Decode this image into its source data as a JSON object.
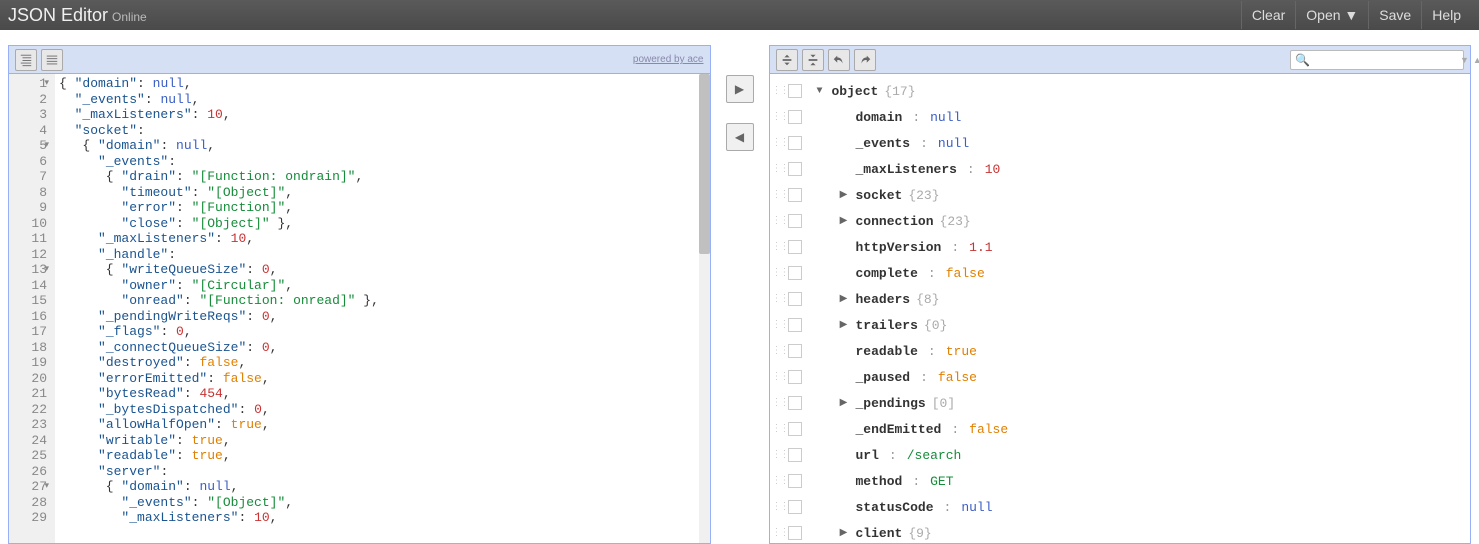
{
  "header": {
    "brand": "JSON Editor",
    "brand_sub": "Online",
    "menu": [
      "Clear",
      "Open ▼",
      "Save",
      "Help"
    ]
  },
  "left_panel": {
    "powered": "powered by ace",
    "code_lines": [
      {
        "n": 1,
        "fold": true,
        "tokens": [
          {
            "t": "punc",
            "v": "{ "
          },
          {
            "t": "key",
            "v": "\"domain\""
          },
          {
            "t": "punc",
            "v": ": "
          },
          {
            "t": "null",
            "v": "null"
          },
          {
            "t": "punc",
            "v": ","
          }
        ]
      },
      {
        "n": 2,
        "tokens": [
          {
            "t": "punc",
            "v": "  "
          },
          {
            "t": "key",
            "v": "\"_events\""
          },
          {
            "t": "punc",
            "v": ": "
          },
          {
            "t": "null",
            "v": "null"
          },
          {
            "t": "punc",
            "v": ","
          }
        ]
      },
      {
        "n": 3,
        "tokens": [
          {
            "t": "punc",
            "v": "  "
          },
          {
            "t": "key",
            "v": "\"_maxListeners\""
          },
          {
            "t": "punc",
            "v": ": "
          },
          {
            "t": "num",
            "v": "10"
          },
          {
            "t": "punc",
            "v": ","
          }
        ]
      },
      {
        "n": 4,
        "tokens": [
          {
            "t": "punc",
            "v": "  "
          },
          {
            "t": "key",
            "v": "\"socket\""
          },
          {
            "t": "punc",
            "v": ":"
          }
        ]
      },
      {
        "n": 5,
        "fold": true,
        "tokens": [
          {
            "t": "punc",
            "v": "   { "
          },
          {
            "t": "key",
            "v": "\"domain\""
          },
          {
            "t": "punc",
            "v": ": "
          },
          {
            "t": "null",
            "v": "null"
          },
          {
            "t": "punc",
            "v": ","
          }
        ]
      },
      {
        "n": 6,
        "tokens": [
          {
            "t": "punc",
            "v": "     "
          },
          {
            "t": "key",
            "v": "\"_events\""
          },
          {
            "t": "punc",
            "v": ":"
          }
        ]
      },
      {
        "n": 7,
        "tokens": [
          {
            "t": "punc",
            "v": "      { "
          },
          {
            "t": "key",
            "v": "\"drain\""
          },
          {
            "t": "punc",
            "v": ": "
          },
          {
            "t": "str",
            "v": "\"[Function: ondrain]\""
          },
          {
            "t": "punc",
            "v": ","
          }
        ]
      },
      {
        "n": 8,
        "tokens": [
          {
            "t": "punc",
            "v": "        "
          },
          {
            "t": "key",
            "v": "\"timeout\""
          },
          {
            "t": "punc",
            "v": ": "
          },
          {
            "t": "str",
            "v": "\"[Object]\""
          },
          {
            "t": "punc",
            "v": ","
          }
        ]
      },
      {
        "n": 9,
        "tokens": [
          {
            "t": "punc",
            "v": "        "
          },
          {
            "t": "key",
            "v": "\"error\""
          },
          {
            "t": "punc",
            "v": ": "
          },
          {
            "t": "str",
            "v": "\"[Function]\""
          },
          {
            "t": "punc",
            "v": ","
          }
        ]
      },
      {
        "n": 10,
        "tokens": [
          {
            "t": "punc",
            "v": "        "
          },
          {
            "t": "key",
            "v": "\"close\""
          },
          {
            "t": "punc",
            "v": ": "
          },
          {
            "t": "str",
            "v": "\"[Object]\""
          },
          {
            "t": "punc",
            "v": " },"
          }
        ]
      },
      {
        "n": 11,
        "tokens": [
          {
            "t": "punc",
            "v": "     "
          },
          {
            "t": "key",
            "v": "\"_maxListeners\""
          },
          {
            "t": "punc",
            "v": ": "
          },
          {
            "t": "num",
            "v": "10"
          },
          {
            "t": "punc",
            "v": ","
          }
        ]
      },
      {
        "n": 12,
        "tokens": [
          {
            "t": "punc",
            "v": "     "
          },
          {
            "t": "key",
            "v": "\"_handle\""
          },
          {
            "t": "punc",
            "v": ":"
          }
        ]
      },
      {
        "n": 13,
        "fold": true,
        "tokens": [
          {
            "t": "punc",
            "v": "      { "
          },
          {
            "t": "key",
            "v": "\"writeQueueSize\""
          },
          {
            "t": "punc",
            "v": ": "
          },
          {
            "t": "num",
            "v": "0"
          },
          {
            "t": "punc",
            "v": ","
          }
        ]
      },
      {
        "n": 14,
        "tokens": [
          {
            "t": "punc",
            "v": "        "
          },
          {
            "t": "key",
            "v": "\"owner\""
          },
          {
            "t": "punc",
            "v": ": "
          },
          {
            "t": "str",
            "v": "\"[Circular]\""
          },
          {
            "t": "punc",
            "v": ","
          }
        ]
      },
      {
        "n": 15,
        "tokens": [
          {
            "t": "punc",
            "v": "        "
          },
          {
            "t": "key",
            "v": "\"onread\""
          },
          {
            "t": "punc",
            "v": ": "
          },
          {
            "t": "str",
            "v": "\"[Function: onread]\""
          },
          {
            "t": "punc",
            "v": " },"
          }
        ]
      },
      {
        "n": 16,
        "tokens": [
          {
            "t": "punc",
            "v": "     "
          },
          {
            "t": "key",
            "v": "\"_pendingWriteReqs\""
          },
          {
            "t": "punc",
            "v": ": "
          },
          {
            "t": "num",
            "v": "0"
          },
          {
            "t": "punc",
            "v": ","
          }
        ]
      },
      {
        "n": 17,
        "tokens": [
          {
            "t": "punc",
            "v": "     "
          },
          {
            "t": "key",
            "v": "\"_flags\""
          },
          {
            "t": "punc",
            "v": ": "
          },
          {
            "t": "num",
            "v": "0"
          },
          {
            "t": "punc",
            "v": ","
          }
        ]
      },
      {
        "n": 18,
        "tokens": [
          {
            "t": "punc",
            "v": "     "
          },
          {
            "t": "key",
            "v": "\"_connectQueueSize\""
          },
          {
            "t": "punc",
            "v": ": "
          },
          {
            "t": "num",
            "v": "0"
          },
          {
            "t": "punc",
            "v": ","
          }
        ]
      },
      {
        "n": 19,
        "tokens": [
          {
            "t": "punc",
            "v": "     "
          },
          {
            "t": "key",
            "v": "\"destroyed\""
          },
          {
            "t": "punc",
            "v": ": "
          },
          {
            "t": "bool",
            "v": "false"
          },
          {
            "t": "punc",
            "v": ","
          }
        ]
      },
      {
        "n": 20,
        "tokens": [
          {
            "t": "punc",
            "v": "     "
          },
          {
            "t": "key",
            "v": "\"errorEmitted\""
          },
          {
            "t": "punc",
            "v": ": "
          },
          {
            "t": "bool",
            "v": "false"
          },
          {
            "t": "punc",
            "v": ","
          }
        ]
      },
      {
        "n": 21,
        "tokens": [
          {
            "t": "punc",
            "v": "     "
          },
          {
            "t": "key",
            "v": "\"bytesRead\""
          },
          {
            "t": "punc",
            "v": ": "
          },
          {
            "t": "num",
            "v": "454"
          },
          {
            "t": "punc",
            "v": ","
          }
        ]
      },
      {
        "n": 22,
        "tokens": [
          {
            "t": "punc",
            "v": "     "
          },
          {
            "t": "key",
            "v": "\"_bytesDispatched\""
          },
          {
            "t": "punc",
            "v": ": "
          },
          {
            "t": "num",
            "v": "0"
          },
          {
            "t": "punc",
            "v": ","
          }
        ]
      },
      {
        "n": 23,
        "tokens": [
          {
            "t": "punc",
            "v": "     "
          },
          {
            "t": "key",
            "v": "\"allowHalfOpen\""
          },
          {
            "t": "punc",
            "v": ": "
          },
          {
            "t": "bool",
            "v": "true"
          },
          {
            "t": "punc",
            "v": ","
          }
        ]
      },
      {
        "n": 24,
        "tokens": [
          {
            "t": "punc",
            "v": "     "
          },
          {
            "t": "key",
            "v": "\"writable\""
          },
          {
            "t": "punc",
            "v": ": "
          },
          {
            "t": "bool",
            "v": "true"
          },
          {
            "t": "punc",
            "v": ","
          }
        ]
      },
      {
        "n": 25,
        "tokens": [
          {
            "t": "punc",
            "v": "     "
          },
          {
            "t": "key",
            "v": "\"readable\""
          },
          {
            "t": "punc",
            "v": ": "
          },
          {
            "t": "bool",
            "v": "true"
          },
          {
            "t": "punc",
            "v": ","
          }
        ]
      },
      {
        "n": 26,
        "tokens": [
          {
            "t": "punc",
            "v": "     "
          },
          {
            "t": "key",
            "v": "\"server\""
          },
          {
            "t": "punc",
            "v": ":"
          }
        ]
      },
      {
        "n": 27,
        "fold": true,
        "tokens": [
          {
            "t": "punc",
            "v": "      { "
          },
          {
            "t": "key",
            "v": "\"domain\""
          },
          {
            "t": "punc",
            "v": ": "
          },
          {
            "t": "null",
            "v": "null"
          },
          {
            "t": "punc",
            "v": ","
          }
        ]
      },
      {
        "n": 28,
        "tokens": [
          {
            "t": "punc",
            "v": "        "
          },
          {
            "t": "key",
            "v": "\"_events\""
          },
          {
            "t": "punc",
            "v": ": "
          },
          {
            "t": "str",
            "v": "\"[Object]\""
          },
          {
            "t": "punc",
            "v": ","
          }
        ]
      },
      {
        "n": 29,
        "tokens": [
          {
            "t": "punc",
            "v": "        "
          },
          {
            "t": "key",
            "v": "\"_maxListeners\""
          },
          {
            "t": "punc",
            "v": ": "
          },
          {
            "t": "num",
            "v": "10"
          },
          {
            "t": "punc",
            "v": ","
          }
        ]
      }
    ]
  },
  "right_panel": {
    "tree": [
      {
        "indent": 0,
        "expand": "▼",
        "key": "object",
        "count": "{17}"
      },
      {
        "indent": 1,
        "key": "domain",
        "sep": ":",
        "val": "null",
        "vt": "null"
      },
      {
        "indent": 1,
        "key": "_events",
        "sep": ":",
        "val": "null",
        "vt": "null"
      },
      {
        "indent": 1,
        "key": "_maxListeners",
        "sep": ":",
        "val": "10",
        "vt": "num"
      },
      {
        "indent": 1,
        "expand": "▶",
        "key": "socket",
        "count": "{23}"
      },
      {
        "indent": 1,
        "expand": "▶",
        "key": "connection",
        "count": "{23}"
      },
      {
        "indent": 1,
        "key": "httpVersion",
        "sep": ":",
        "val": "1.1",
        "vt": "num"
      },
      {
        "indent": 1,
        "key": "complete",
        "sep": ":",
        "val": "false",
        "vt": "bool"
      },
      {
        "indent": 1,
        "expand": "▶",
        "key": "headers",
        "count": "{8}"
      },
      {
        "indent": 1,
        "expand": "▶",
        "key": "trailers",
        "count": "{0}"
      },
      {
        "indent": 1,
        "key": "readable",
        "sep": ":",
        "val": "true",
        "vt": "bool"
      },
      {
        "indent": 1,
        "key": "_paused",
        "sep": ":",
        "val": "false",
        "vt": "bool"
      },
      {
        "indent": 1,
        "expand": "▶",
        "key": "_pendings",
        "count": "[0]"
      },
      {
        "indent": 1,
        "key": "_endEmitted",
        "sep": ":",
        "val": "false",
        "vt": "bool"
      },
      {
        "indent": 1,
        "key": "url",
        "sep": ":",
        "val": "/search",
        "vt": "str"
      },
      {
        "indent": 1,
        "key": "method",
        "sep": ":",
        "val": "GET",
        "vt": "str"
      },
      {
        "indent": 1,
        "key": "statusCode",
        "sep": ":",
        "val": "null",
        "vt": "null"
      },
      {
        "indent": 1,
        "expand": "▶",
        "key": "client",
        "count": "{9}"
      }
    ]
  }
}
